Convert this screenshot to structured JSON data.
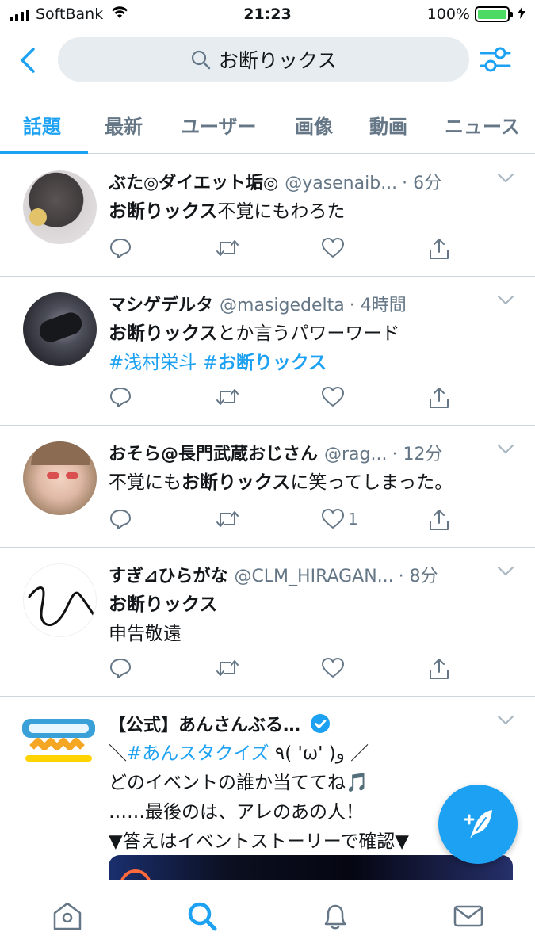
{
  "status_bar": {
    "carrier": "SoftBank",
    "time": "21:23",
    "battery": "100%",
    "battery_level": 1.0
  },
  "search": {
    "query": "お断りックス",
    "back_icon": "chevron-left-icon",
    "filter_icon": "sliders-icon",
    "search_icon": "magnifier-icon"
  },
  "tabs": [
    {
      "label": "話題",
      "active": true
    },
    {
      "label": "最新"
    },
    {
      "label": "ユーザー"
    },
    {
      "label": "画像"
    },
    {
      "label": "動画"
    },
    {
      "label": "ニュース"
    }
  ],
  "tweets": [
    {
      "name": "ぶた◎ダイエット垢◎",
      "handle": "@yasenaib...",
      "time": "· 6分",
      "text_bold": "お断りックス",
      "text_rest": "不覚にもわろた"
    },
    {
      "name": "マシゲデルタ",
      "handle": "@masigedelta",
      "time": "· 4時間",
      "text_bold": "お断りックス",
      "text_rest": "とか言うパワーワード",
      "hashtag1": "#浅村栄斗",
      "hashtag2_prefix": "#",
      "hashtag2_bold": "お断りックス"
    },
    {
      "name": "おそら@長門武蔵おじさん",
      "handle": "@rag...",
      "time": "· 12分",
      "text_pre": "不覚にも",
      "text_bold": "お断りックス",
      "text_rest": "に笑ってしまった。",
      "like_count": "1"
    },
    {
      "name": "すぎ⊿ひらがな",
      "handle": "@CLM_HIRAGAN...",
      "time": "· 8分",
      "text_bold": "お断りックス",
      "text_line2": "申告敬遠",
      "avatar_text": "ひ"
    },
    {
      "name": "【公式】あんさんぶる…",
      "verified": true,
      "line1_pre": "＼",
      "line1_hashtag": "#あんスタクイズ",
      "line1_post": " ٩( 'ω' )و ／",
      "line2": "どのイベントの誰か当ててね🎵",
      "line3": "……最後のは、アレのあの人！",
      "line4": "▼答えはイベントストーリーで確認▼"
    }
  ],
  "nav": [
    "home-icon",
    "search-icon",
    "bell-icon",
    "mail-icon"
  ],
  "colors": {
    "accent": "#1da1f2",
    "muted": "#657786",
    "divider": "#ccd6dd",
    "search_bg": "#e6ecf0"
  }
}
